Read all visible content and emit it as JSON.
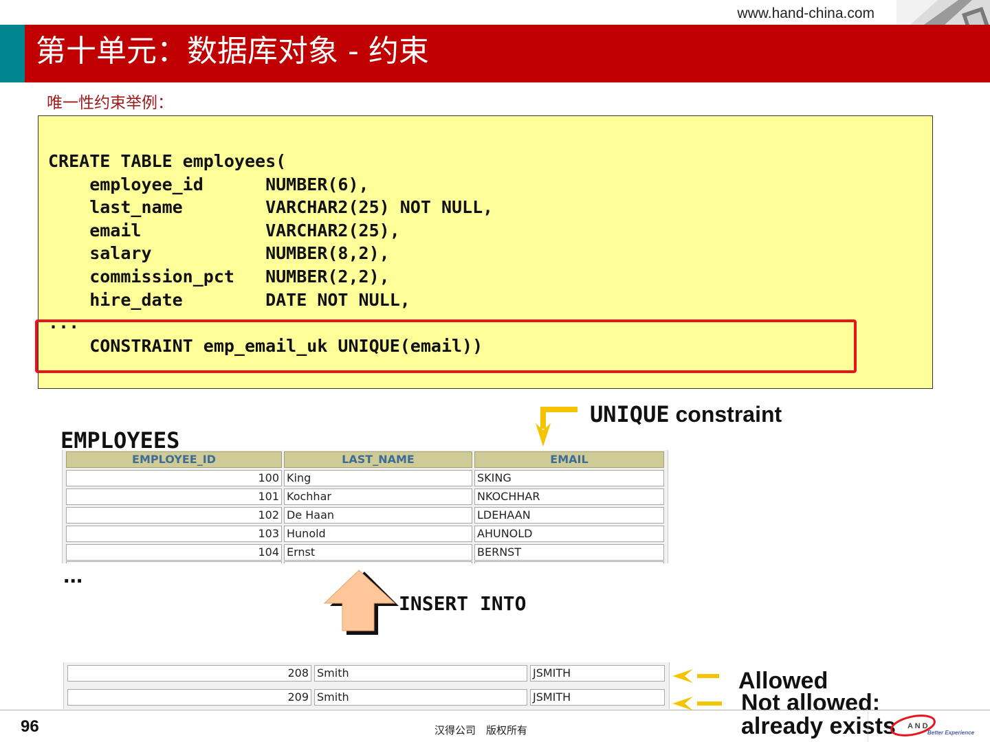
{
  "header": {
    "url": "www.hand-china.com",
    "title": "第十单元：数据库对象 - 约束"
  },
  "subtitle": "唯一性约束举例：",
  "code": {
    "lines": [
      "CREATE TABLE employees(",
      "    employee_id      NUMBER(6),",
      "    last_name        VARCHAR2(25) NOT NULL,",
      "    email            VARCHAR2(25),",
      "    salary           NUMBER(8,2),",
      "    commission_pct   NUMBER(2,2),",
      "    hire_date        DATE NOT NULL,",
      "...",
      "    CONSTRAINT emp_email_uk UNIQUE(email))"
    ]
  },
  "diagram": {
    "unique_keyword": "UNIQUE",
    "unique_rest": " constraint",
    "table_title": "EMPLOYEES",
    "columns": [
      "EMPLOYEE_ID",
      "LAST_NAME",
      "EMAIL"
    ],
    "rows": [
      [
        "100",
        "King",
        "SKING"
      ],
      [
        "101",
        "Kochhar",
        "NKOCHHAR"
      ],
      [
        "102",
        "De Haan",
        "LDEHAAN"
      ],
      [
        "103",
        "Hunold",
        "AHUNOLD"
      ],
      [
        "104",
        "Ernst",
        "BERNST"
      ]
    ],
    "ellipsis": "...",
    "insert_label": "INSERT INTO",
    "new_rows": [
      [
        "208",
        "Smith",
        "JSMITH"
      ],
      [
        "209",
        "Smith",
        "JSMITH"
      ]
    ],
    "allowed_label": "Allowed",
    "not_allowed_line1": "Not allowed:",
    "not_allowed_line2": "already exists"
  },
  "footer": {
    "page_number": "96",
    "copyright": "汉得公司　版权所有",
    "logo_tagline": "Better Experience"
  },
  "colors": {
    "title_bar": "#c00000",
    "accent_teal": "#00868f",
    "code_background": "#ffff99",
    "highlight_box": "#e8141c",
    "pointer_arrows": "#f5c400",
    "insert_arrow": "#ffc69a"
  }
}
